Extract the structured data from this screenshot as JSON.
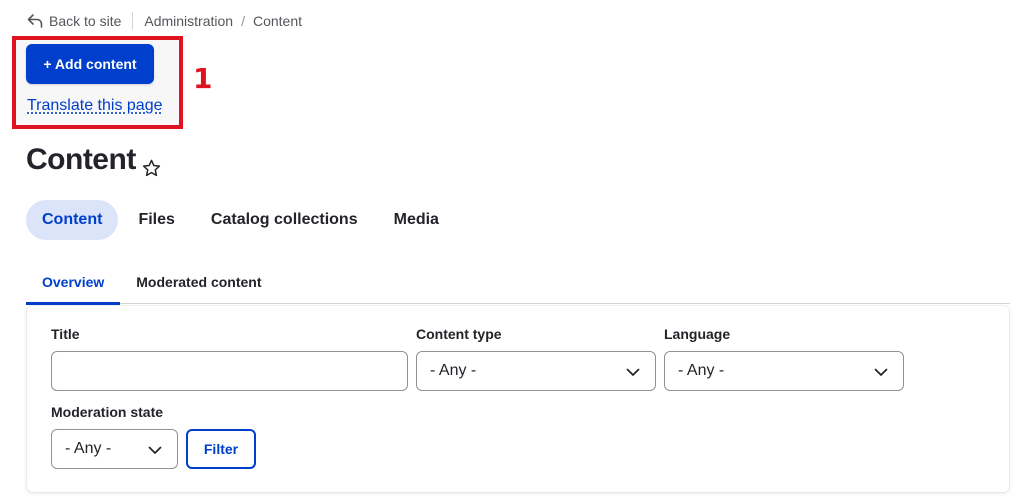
{
  "breadcrumb": {
    "back_label": "Back to site",
    "items": [
      "Administration",
      "Content"
    ],
    "separator": "/"
  },
  "actions": {
    "add_content": "+ Add content",
    "translate": "Translate this page"
  },
  "annotation": {
    "number": "1",
    "color": "#e0121f"
  },
  "page": {
    "title": "Content"
  },
  "primary_tabs": [
    "Content",
    "Files",
    "Catalog collections",
    "Media"
  ],
  "secondary_tabs": [
    "Overview",
    "Moderated content"
  ],
  "filters": {
    "title_label": "Title",
    "title_value": "",
    "content_type_label": "Content type",
    "content_type_value": "- Any -",
    "language_label": "Language",
    "language_value": "- Any -",
    "moderation_label": "Moderation state",
    "moderation_value": "- Any -",
    "filter_button": "Filter"
  },
  "colors": {
    "accent": "#003ecc",
    "active_tab_bg": "#dbe4f9"
  }
}
